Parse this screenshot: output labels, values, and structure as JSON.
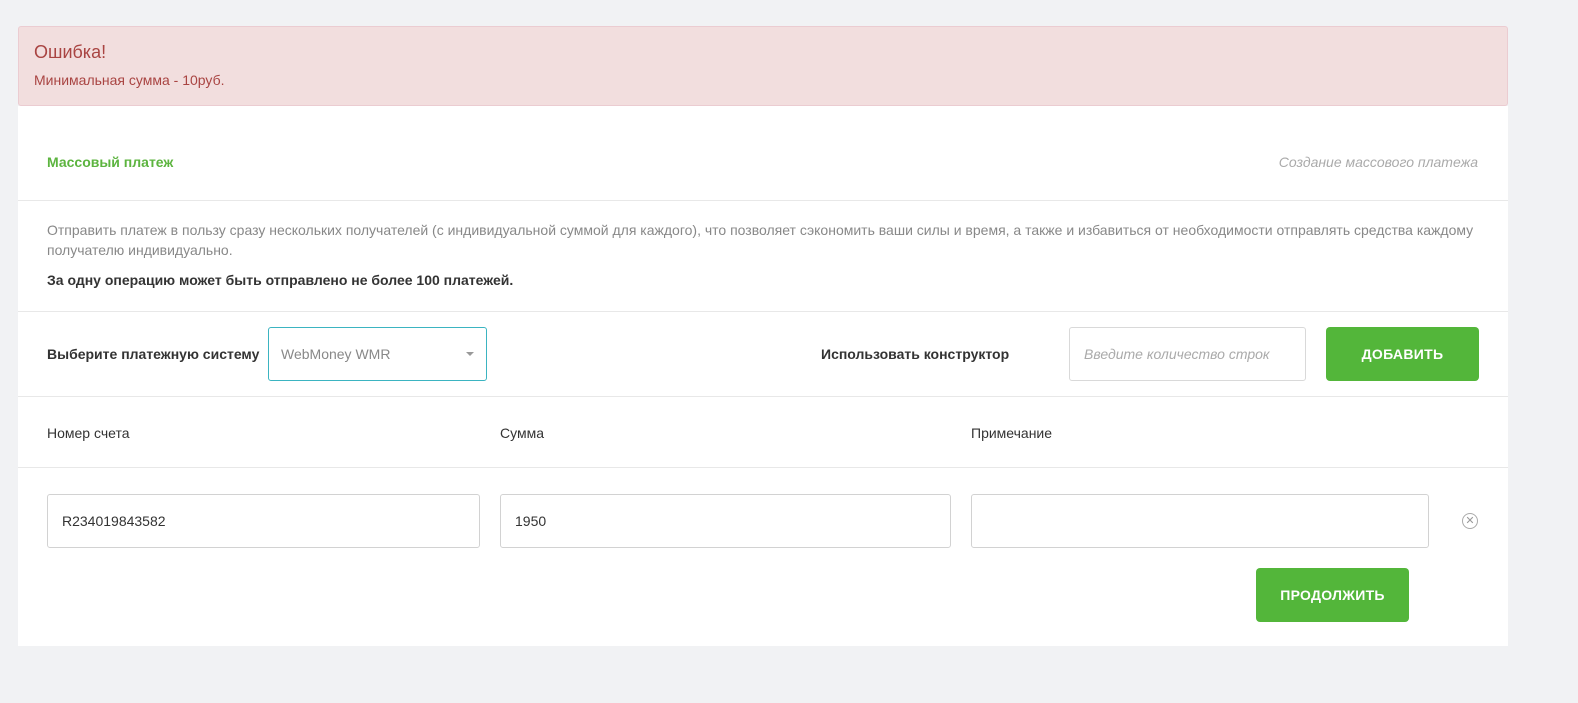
{
  "alert": {
    "title": "Ошибка!",
    "message": "Минимальная сумма - 10руб."
  },
  "panel": {
    "title": "Массовый платеж",
    "subtitle": "Создание массового платежа"
  },
  "description": {
    "text": "Отправить платеж в пользу сразу нескольких получателей (с индивидуальной суммой для каждого), что позволяет сэкономить ваши силы и время, а также и избавиться от необходимости отправлять средства каждому получателю индивидуально.",
    "limit": "За одну операцию может быть отправлено не более 100 платежей."
  },
  "controls": {
    "system_label": "Выберите платежную систему",
    "system_value": "WebMoney WMR",
    "constructor_label": "Использовать конструктор",
    "rows_placeholder": "Введите количество строк",
    "add_label": "ДОБАВИТЬ"
  },
  "columns": {
    "account": "Номер счета",
    "amount": "Сумма",
    "note": "Примечание"
  },
  "payment_row": {
    "account": "R234019843582",
    "amount": "1950",
    "note": "",
    "remove_icon": "close-circle-icon"
  },
  "continue_label": "ПРОДОЛЖИТЬ",
  "colors": {
    "accent": "#53b63a",
    "error_bg": "#f2dede",
    "error_text": "#a94442",
    "focus_border": "#3bb4c1"
  }
}
